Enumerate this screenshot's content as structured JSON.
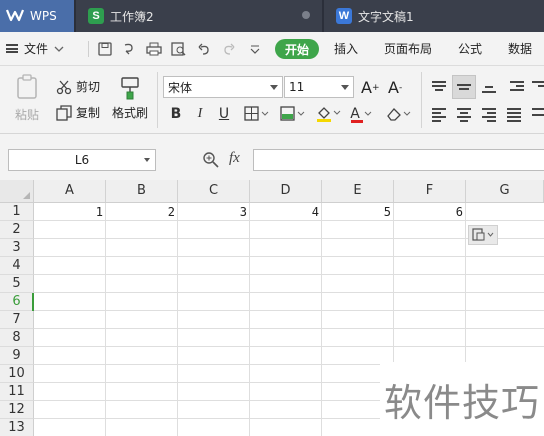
{
  "tabs": [
    {
      "label": "WPS",
      "badge": "W",
      "color": "#4a6ea9"
    },
    {
      "label": "工作簿2",
      "badge": "S",
      "color": "#2e9e4f"
    },
    {
      "label": "文字文稿1",
      "badge": "W",
      "color": "#3b78d8"
    }
  ],
  "menubar": {
    "file_label": "文件",
    "start_label": "开始",
    "items": [
      "插入",
      "页面布局",
      "公式",
      "数据"
    ]
  },
  "ribbon": {
    "paste_label": "粘贴",
    "cut_label": "剪切",
    "copy_label": "复制",
    "format_painter_label": "格式刷",
    "font_name": "宋体",
    "font_size": "11",
    "grow_font": "A",
    "shrink_font": "A",
    "bold": "B",
    "italic": "I",
    "underline": "U",
    "font_color_letter": "A"
  },
  "formula_bar": {
    "cell_ref": "L6",
    "fx_label": "fx",
    "formula_value": ""
  },
  "grid": {
    "columns": [
      "A",
      "B",
      "C",
      "D",
      "E",
      "F",
      "G"
    ],
    "rows": [
      "1",
      "2",
      "3",
      "4",
      "5",
      "6",
      "7",
      "8",
      "9",
      "10",
      "11",
      "12",
      "13"
    ],
    "active_row": "6",
    "row1_values": [
      "1",
      "2",
      "3",
      "4",
      "5",
      "6"
    ]
  },
  "watermark": "软件技巧",
  "colors": {
    "tabbar_bg": "#2b2f3a",
    "active_tab": "#4a6ea9",
    "start_tab_green": "#3ea54a",
    "active_row_green": "#3a9d3a"
  }
}
